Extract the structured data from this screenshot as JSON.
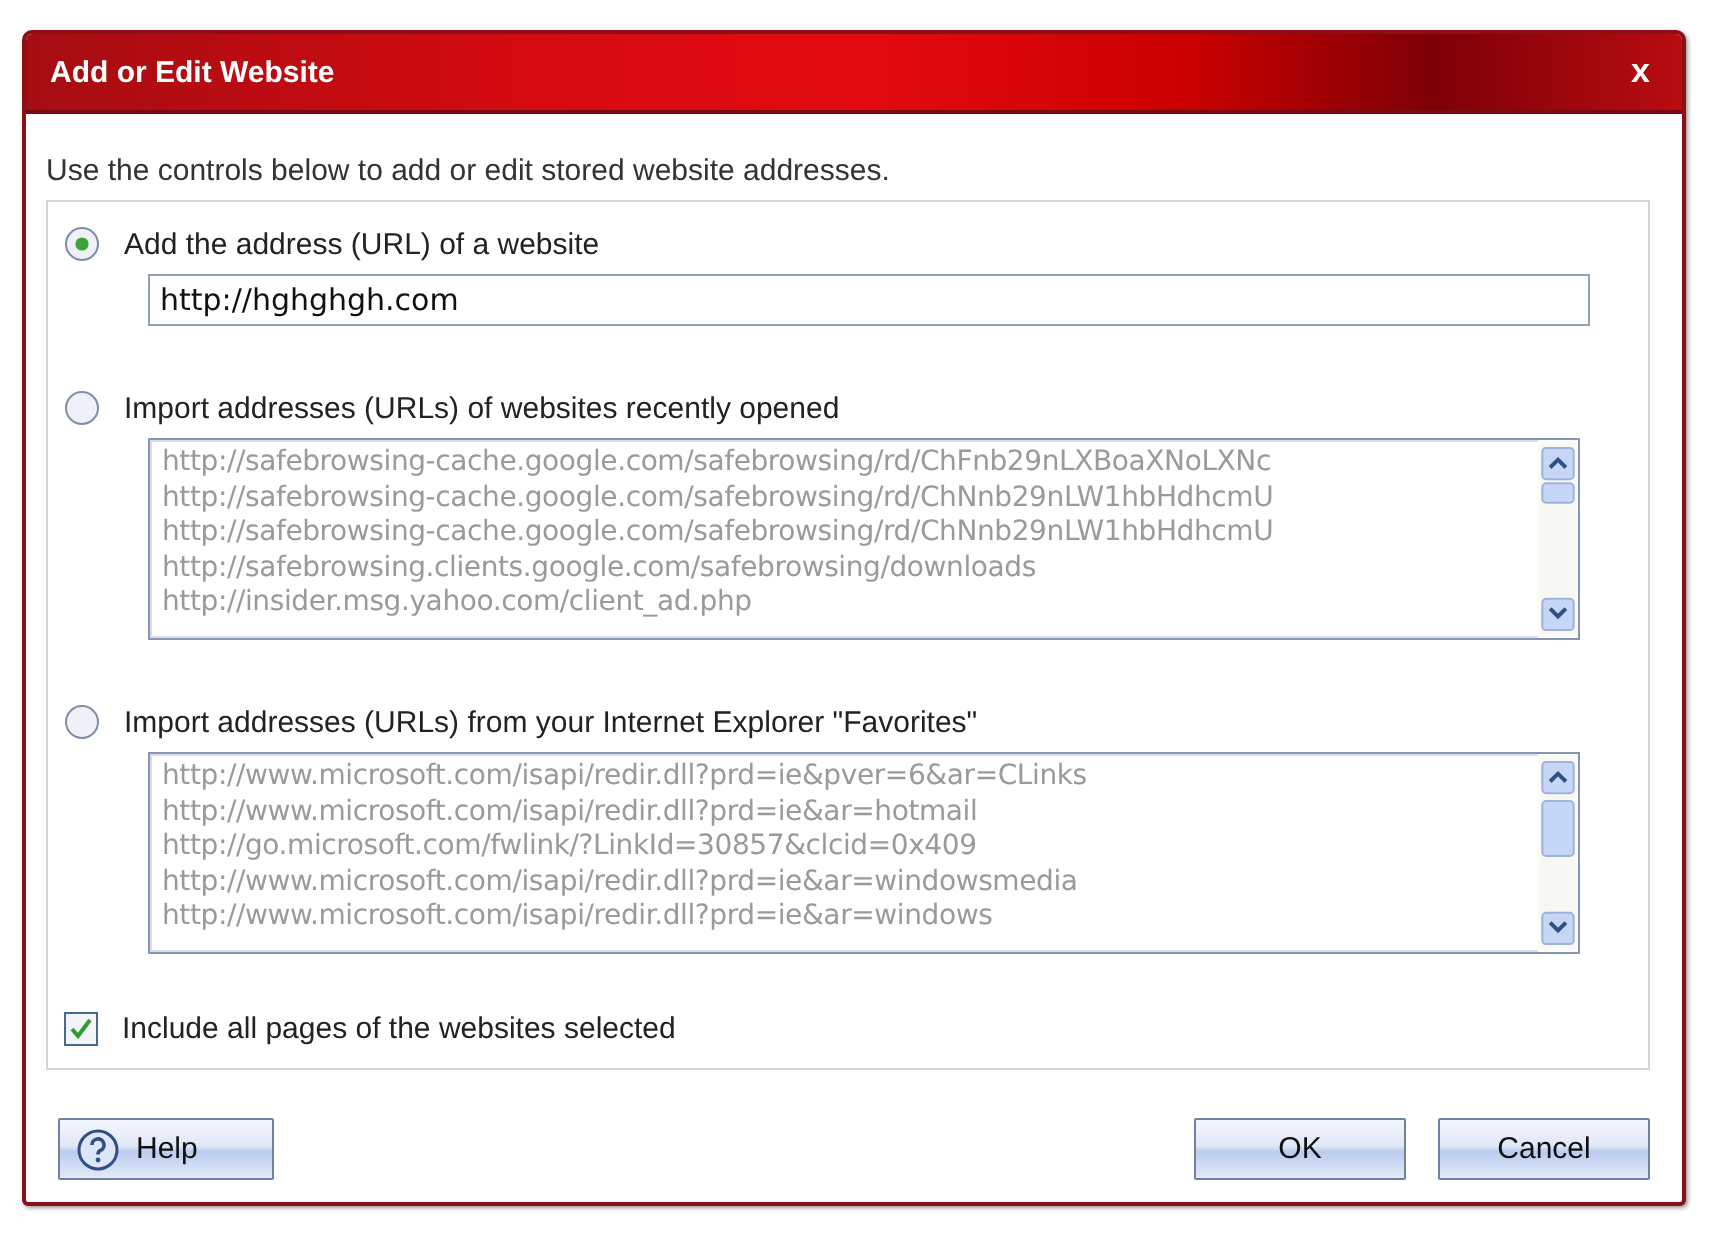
{
  "window": {
    "title": "Add or Edit Website",
    "close": "x"
  },
  "intro": "Use the controls below to add or edit stored website addresses.",
  "options": [
    {
      "kind": "field",
      "label": "Add the address (URL) of a website",
      "selected": true,
      "value": "http://hghghgh.com"
    },
    {
      "kind": "list",
      "label": "Import addresses (URLs) of websites recently opened",
      "selected": false,
      "disabled": true,
      "items": [
        "http://safebrowsing-cache.google.com/safebrowsing/rd/ChFnb29nLXBoaXNoLXNc",
        "http://safebrowsing-cache.google.com/safebrowsing/rd/ChNnb29nLW1hbHdhcmU",
        "http://safebrowsing-cache.google.com/safebrowsing/rd/ChNnb29nLW1hbHdhcmU",
        "http://safebrowsing.clients.google.com/safebrowsing/downloads",
        "http://insider.msg.yahoo.com/client_ad.php"
      ]
    },
    {
      "kind": "list",
      "label": "Import addresses (URLs) from your Internet Explorer \"Favorites\"",
      "selected": false,
      "disabled": true,
      "items": [
        "http://www.microsoft.com/isapi/redir.dll?prd=ie&pver=6&ar=CLinks",
        "http://www.microsoft.com/isapi/redir.dll?prd=ie&ar=hotmail",
        "http://go.microsoft.com/fwlink/?LinkId=30857&clcid=0x409",
        "http://www.microsoft.com/isapi/redir.dll?prd=ie&ar=windowsmedia",
        "http://www.microsoft.com/isapi/redir.dll?prd=ie&ar=windows"
      ]
    }
  ],
  "include_all_pages": {
    "label": "Include all pages of the websites selected",
    "checked": true
  },
  "buttons": [
    {
      "kind": "help",
      "label": "Help"
    },
    {
      "kind": "ok",
      "label": "OK"
    },
    {
      "kind": "cancel",
      "label": "Cancel"
    }
  ]
}
